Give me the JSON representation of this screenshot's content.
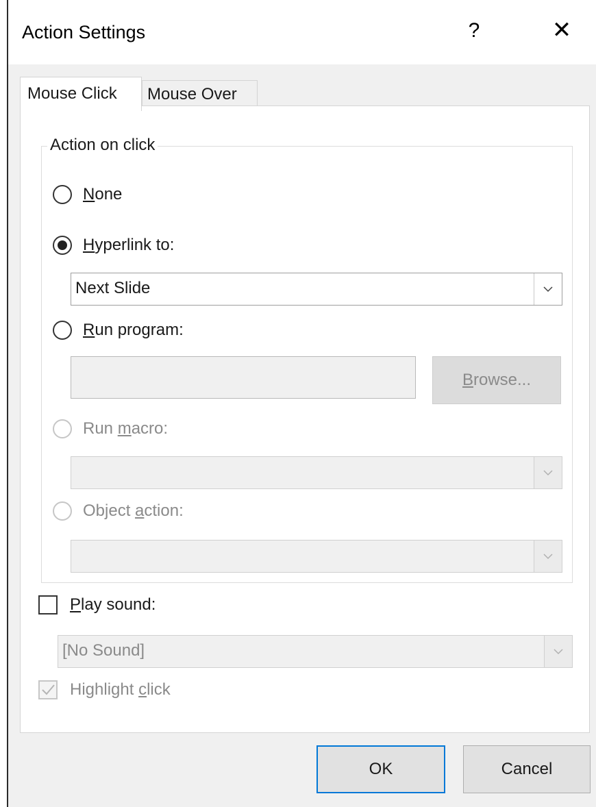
{
  "window": {
    "title": "Action Settings",
    "help_label": "?",
    "close_label": "✕"
  },
  "tabs": [
    {
      "label": "Mouse Click",
      "active": true
    },
    {
      "label": "Mouse Over",
      "active": false
    }
  ],
  "action_group": {
    "legend": "Action on click",
    "options": [
      {
        "prefix": "",
        "accel": "N",
        "suffix": "one",
        "checked": false,
        "disabled": false
      },
      {
        "prefix": "",
        "accel": "H",
        "suffix": "yperlink to:",
        "checked": true,
        "disabled": false
      },
      {
        "prefix": "",
        "accel": "R",
        "suffix": "un program:",
        "checked": false,
        "disabled": false
      },
      {
        "prefix": "Run ",
        "accel": "m",
        "suffix": "acro:",
        "checked": false,
        "disabled": true
      },
      {
        "prefix": "Object ",
        "accel": "a",
        "suffix": "ction:",
        "checked": false,
        "disabled": true
      }
    ],
    "hyperlink_value": "Next Slide",
    "program_value": "",
    "browse": {
      "accel": "B",
      "rest": "rowse..."
    },
    "macro_value": "",
    "object_value": ""
  },
  "play_sound": {
    "accel": "P",
    "rest": "lay sound:",
    "checked": false,
    "sound_value": "[No Sound]"
  },
  "highlight": {
    "prefix": "Highlight ",
    "accel": "c",
    "rest": "lick",
    "checked": true,
    "disabled": true
  },
  "buttons": {
    "ok": "OK",
    "cancel": "Cancel"
  },
  "colors": {
    "accent": "#0078d7",
    "disabled_text": "#8a8a8a"
  }
}
